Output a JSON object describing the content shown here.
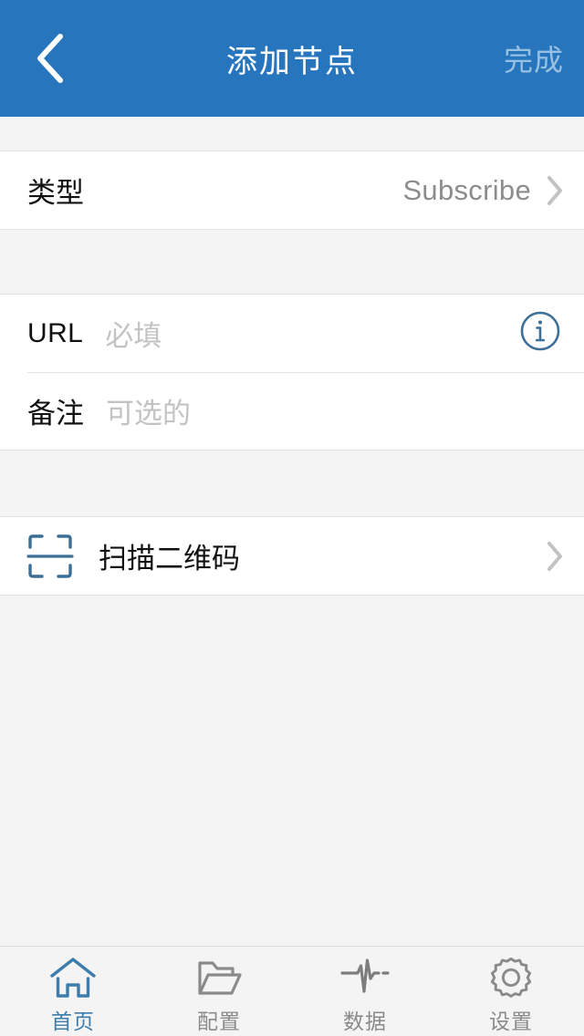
{
  "theme": {
    "header_bg": "#2775bd",
    "header_text": "#ffffff",
    "header_disabled_text": "#98c0e2",
    "page_bg": "#f4f4f4",
    "card_bg": "#ffffff",
    "label_text": "#111111",
    "value_text": "#8d8d8d",
    "placeholder_text": "#c3c3c3",
    "chevron": "#c2c2c2",
    "accent_blue": "#3d7099",
    "tab_active": "#3d7cab",
    "tab_inactive": "#8a8a8a"
  },
  "header": {
    "back_icon": "chevron-left-icon",
    "title": "添加节点",
    "done_label": "完成"
  },
  "sections": {
    "type_section": {
      "label": "类型",
      "value": "Subscribe",
      "chevron_icon": "chevron-right-icon"
    },
    "fields_section": {
      "url": {
        "label": "URL",
        "placeholder": "必填",
        "value": "",
        "info_icon": "info-circle-icon"
      },
      "remark": {
        "label": "备注",
        "placeholder": "可选的",
        "value": ""
      }
    },
    "scan_section": {
      "icon": "qr-scan-icon",
      "label": "扫描二维码",
      "chevron_icon": "chevron-right-icon"
    }
  },
  "tabbar": {
    "items": [
      {
        "label": "首页",
        "icon": "home-icon",
        "active": true
      },
      {
        "label": "配置",
        "icon": "folder-icon",
        "active": false
      },
      {
        "label": "数据",
        "icon": "pulse-icon",
        "active": false
      },
      {
        "label": "设置",
        "icon": "gear-icon",
        "active": false
      }
    ]
  }
}
